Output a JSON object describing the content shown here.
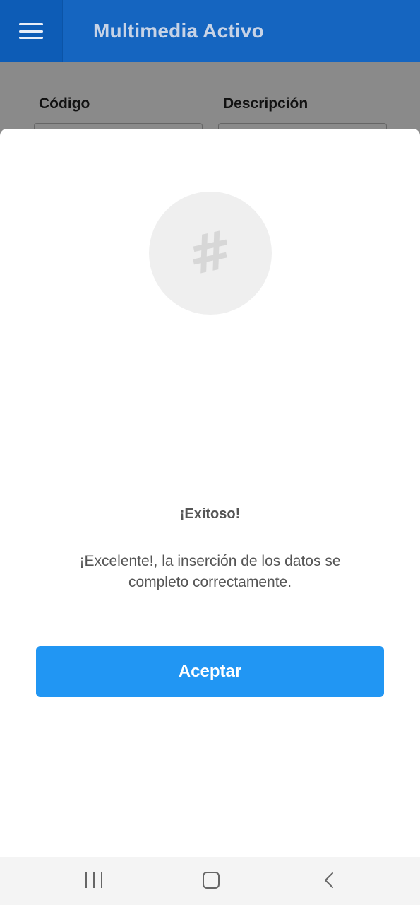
{
  "appbar": {
    "title": "Multimedia Activo",
    "menu_icon": "hamburger-menu-icon",
    "color": "#1565c0"
  },
  "form": {
    "code_label": "Código",
    "description_label": "Descripción"
  },
  "dialog": {
    "icon": "hash-icon",
    "title": "¡Exitoso!",
    "message": "¡Excelente!, la inserción de los datos se completo correctamente.",
    "accept_label": "Aceptar",
    "accept_color": "#2196f3"
  },
  "navbar": {
    "recent_icon": "recent-apps-icon",
    "home_icon": "home-icon",
    "back_icon": "back-icon"
  }
}
